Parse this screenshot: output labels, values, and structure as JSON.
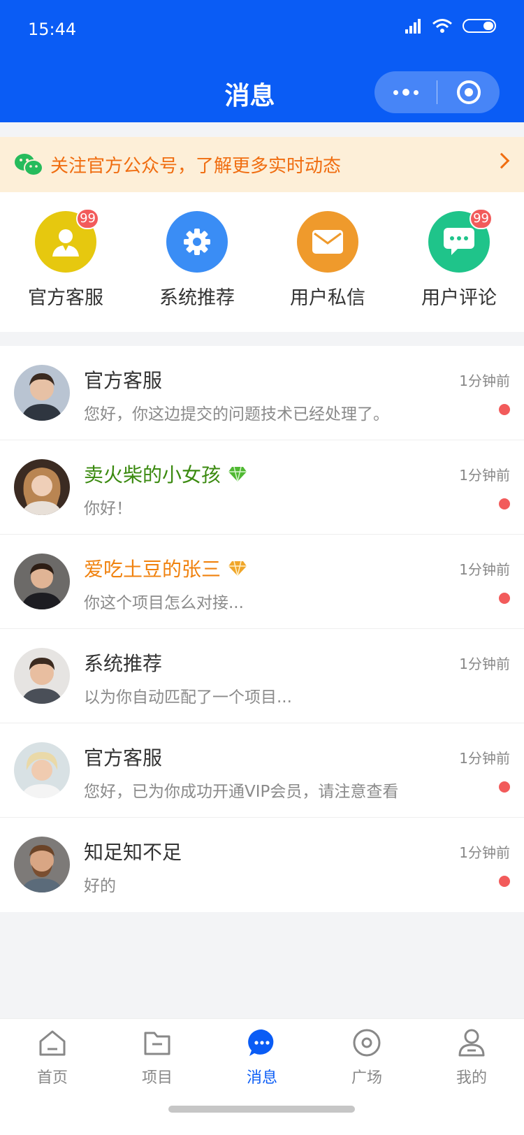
{
  "status_bar": {
    "time": "15:44"
  },
  "header": {
    "title": "消息"
  },
  "notice": {
    "text": "关注官方公众号，了解更多实时动态"
  },
  "quick_actions": [
    {
      "label": "官方客服",
      "icon": "support-agent-icon",
      "color": "#e6c80f",
      "badge": "99"
    },
    {
      "label": "系统推荐",
      "icon": "gear-icon",
      "color": "#3a8df5",
      "badge": ""
    },
    {
      "label": "用户私信",
      "icon": "mail-icon",
      "color": "#ef9a2c",
      "badge": ""
    },
    {
      "label": "用户评论",
      "icon": "chat-bubble-icon",
      "color": "#1fc48a",
      "badge": "99"
    }
  ],
  "messages": [
    {
      "name": "官方客服",
      "time": "1分钟前",
      "preview": "您好，你这边提交的问题技术已经处理了。",
      "unread": true,
      "name_style": "normal",
      "vip": ""
    },
    {
      "name": "卖火柴的小女孩",
      "time": "1分钟前",
      "preview": "你好！",
      "unread": true,
      "name_style": "green",
      "vip": "green-diamond-icon"
    },
    {
      "name": "爱吃土豆的张三",
      "time": "1分钟前",
      "preview": "你这个项目怎么对接...",
      "unread": true,
      "name_style": "orange",
      "vip": "orange-diamond-icon"
    },
    {
      "name": "系统推荐",
      "time": "1分钟前",
      "preview": "以为你自动匹配了一个项目...",
      "unread": false,
      "name_style": "normal",
      "vip": ""
    },
    {
      "name": "官方客服",
      "time": "1分钟前",
      "preview": "您好，已为你成功开通VIP会员，请注意查看",
      "unread": true,
      "name_style": "normal",
      "vip": ""
    },
    {
      "name": "知足知不足",
      "time": "1分钟前",
      "preview": "好的",
      "unread": true,
      "name_style": "normal",
      "vip": ""
    }
  ],
  "tabs": [
    {
      "label": "首页",
      "icon": "home-icon",
      "active": false
    },
    {
      "label": "项目",
      "icon": "folder-icon",
      "active": false
    },
    {
      "label": "消息",
      "icon": "message-icon",
      "active": true
    },
    {
      "label": "广场",
      "icon": "plaza-target-icon",
      "active": false
    },
    {
      "label": "我的",
      "icon": "profile-icon",
      "active": false
    }
  ],
  "colors": {
    "primary": "#0a5cf5",
    "notice_bg": "#fdefd8",
    "notice_text": "#f06d10",
    "unread_dot": "#f25b5b"
  }
}
